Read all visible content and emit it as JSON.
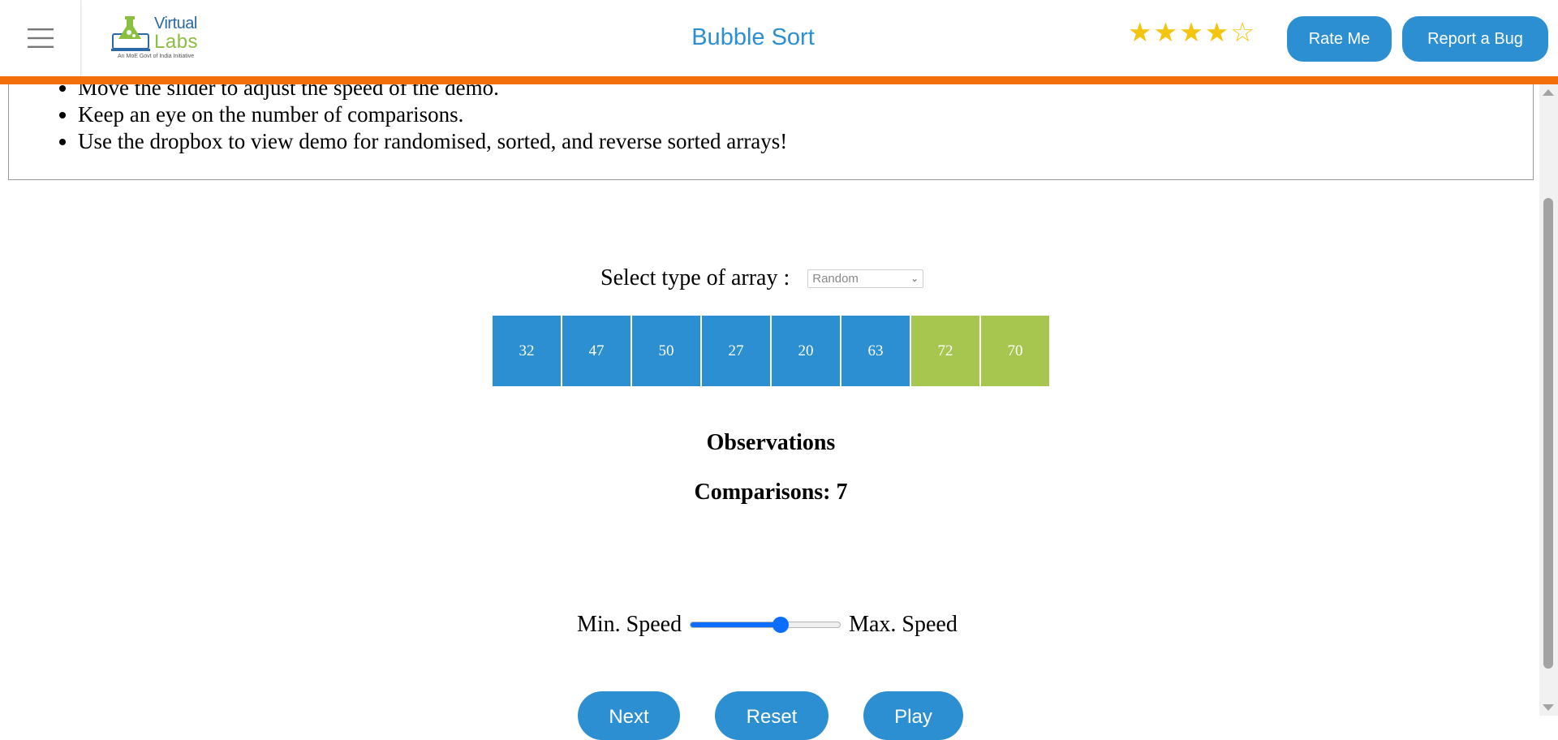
{
  "header": {
    "logo_top": "Virtual",
    "logo_bottom": "Labs",
    "logo_tagline": "An MoE Govt of India Initiative",
    "title": "Bubble Sort",
    "rating": {
      "filled": 4,
      "total": 5
    },
    "rate_label": "Rate Me",
    "bug_label": "Report a Bug",
    "accent_color": "#2b8fd1",
    "bar_color": "#f36f0b"
  },
  "instructions": [
    "Move the slider to adjust the speed of the demo.",
    "Keep an eye on the number of comparisons.",
    "Use the dropbox to view demo for randomised, sorted, and reverse sorted arrays!"
  ],
  "array_type": {
    "label": "Select type of array :",
    "selected": "Random"
  },
  "array": {
    "values": [
      "32",
      "47",
      "50",
      "27",
      "20",
      "63",
      "72",
      "70"
    ],
    "states": [
      "unsorted",
      "unsorted",
      "unsorted",
      "unsorted",
      "unsorted",
      "unsorted",
      "highlighted",
      "highlighted"
    ]
  },
  "observations": {
    "title": "Observations",
    "comparisons": "Comparisons: 7"
  },
  "speed": {
    "min_label": "Min. Speed",
    "max_label": "Max. Speed",
    "value_fraction": 0.6
  },
  "controls": {
    "next_label": "Next",
    "reset_label": "Reset",
    "play_label": "Play"
  }
}
